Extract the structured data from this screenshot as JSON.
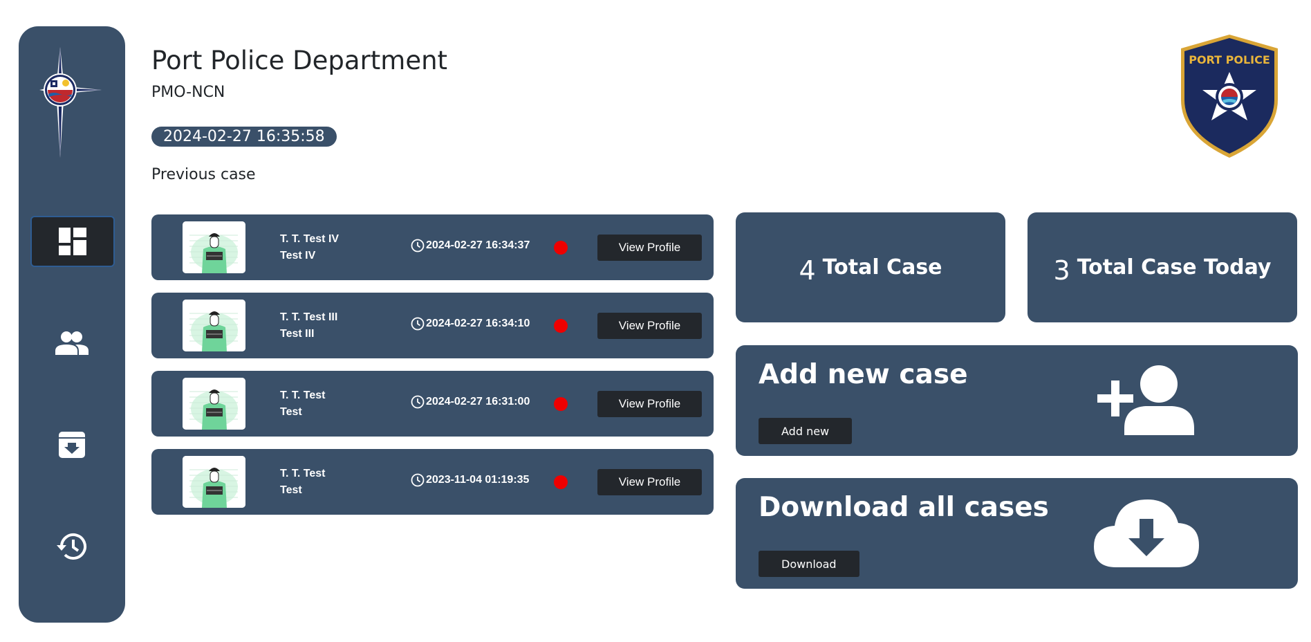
{
  "header": {
    "title": "Port Police Department",
    "subtitle": "PMO-NCN",
    "datetime": "2024-02-27 16:35:58",
    "previous_label": "Previous case"
  },
  "badge": {
    "text": "PORT POLICE"
  },
  "sidebar": {
    "items": [
      {
        "name": "dashboard",
        "icon": "dashboard-icon",
        "active": true
      },
      {
        "name": "people",
        "icon": "people-icon",
        "active": false
      },
      {
        "name": "archive",
        "icon": "archive-download-icon",
        "active": false
      },
      {
        "name": "history",
        "icon": "history-icon",
        "active": false
      }
    ]
  },
  "cases": [
    {
      "name": "T. T. Test IV",
      "alias": "Test IV",
      "time": "2024-02-27 16:34:37",
      "button": "View Profile"
    },
    {
      "name": "T. T. Test III",
      "alias": "Test III",
      "time": "2024-02-27 16:34:10",
      "button": "View Profile"
    },
    {
      "name": "T. T. Test",
      "alias": "Test",
      "time": "2024-02-27 16:31:00",
      "button": "View Profile"
    },
    {
      "name": "T. T. Test",
      "alias": "Test",
      "time": "2023-11-04 01:19:35",
      "button": "View Profile"
    }
  ],
  "stats": {
    "total": {
      "value": "4",
      "label": "Total Case"
    },
    "today": {
      "value": "3",
      "label": "Total Case Today"
    }
  },
  "actions": {
    "add": {
      "title": "Add new case",
      "button": "Add new"
    },
    "download": {
      "title": "Download all cases",
      "button": "Download"
    }
  },
  "colors": {
    "card": "#3a5069",
    "button": "#23272c",
    "status": "#ee0000"
  }
}
